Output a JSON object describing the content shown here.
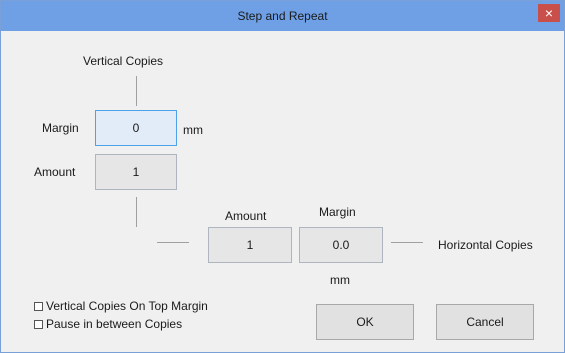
{
  "window": {
    "title": "Step and Repeat",
    "close_glyph": "×"
  },
  "vertical": {
    "header": "Vertical Copies",
    "margin_label": "Margin",
    "margin_value": "0",
    "margin_unit": "mm",
    "amount_label": "Amount",
    "amount_value": "1"
  },
  "horizontal": {
    "amount_label": "Amount",
    "amount_value": "1",
    "margin_label": "Margin",
    "margin_value": "0.0",
    "margin_unit": "mm",
    "footer": "Horizontal Copies"
  },
  "options": [
    {
      "label": "Vertical Copies On Top Margin",
      "checked": false
    },
    {
      "label": "Pause in between Copies",
      "checked": false
    }
  ],
  "buttons": {
    "ok": "OK",
    "cancel": "Cancel"
  }
}
